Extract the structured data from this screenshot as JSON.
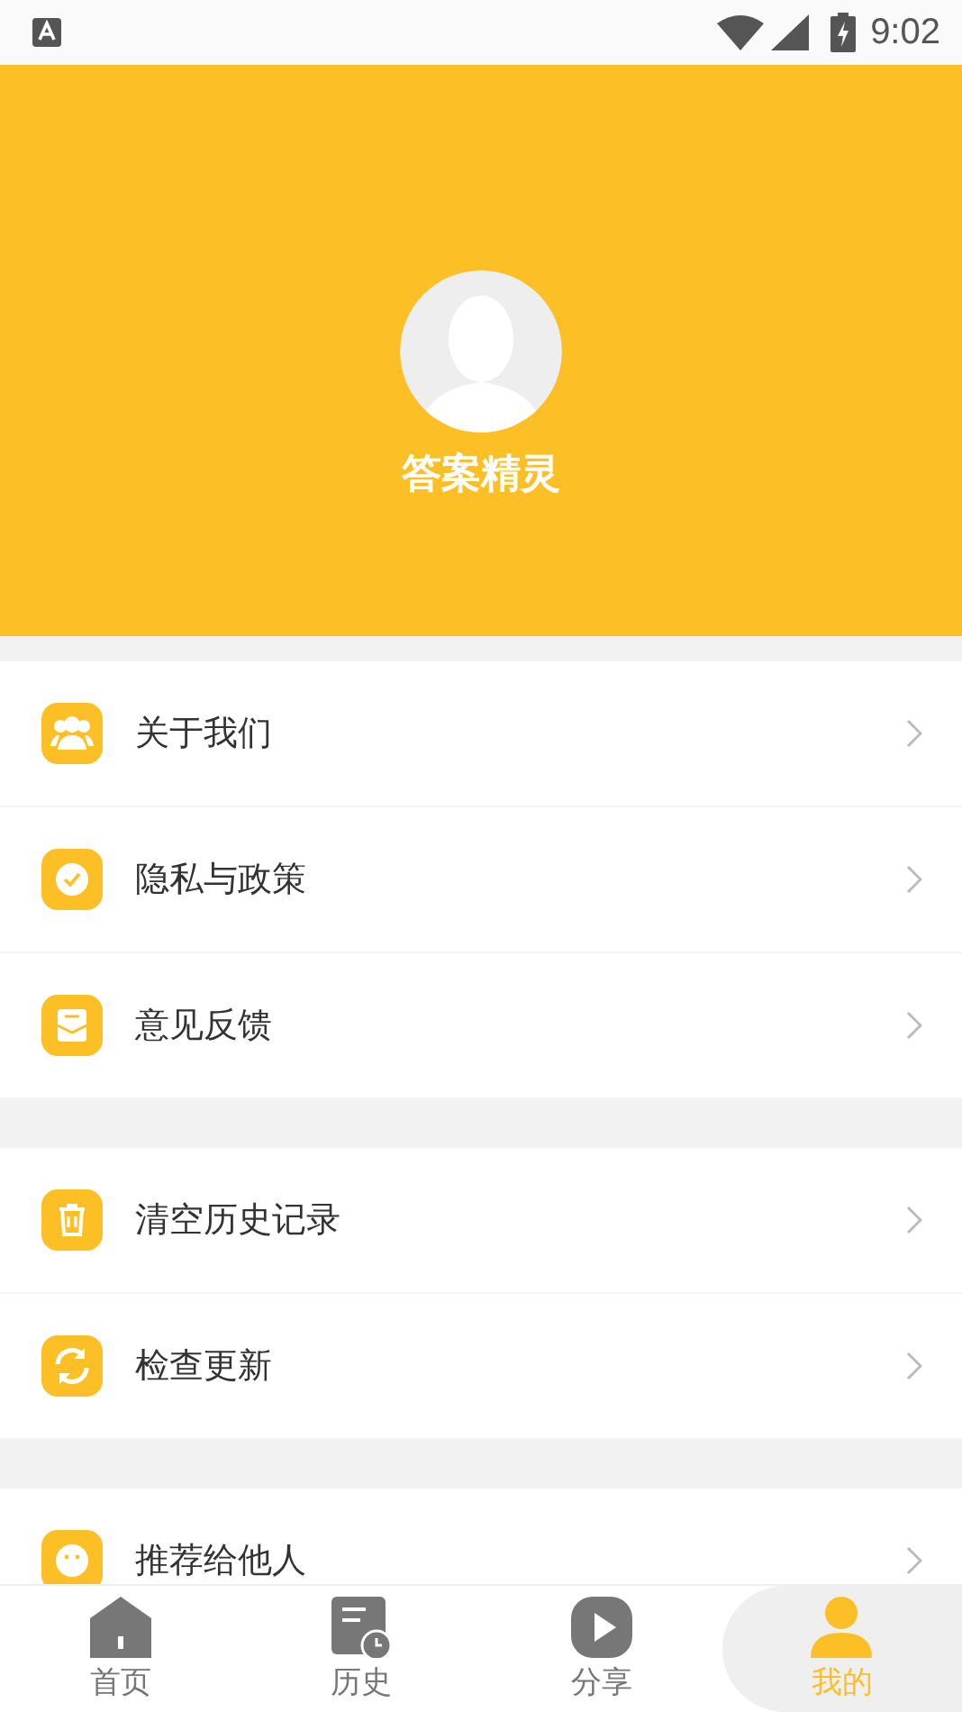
{
  "status_bar": {
    "time": "9:02"
  },
  "profile": {
    "name": "答案精灵"
  },
  "menu_groups": [
    {
      "items": [
        {
          "label": "关于我们"
        },
        {
          "label": "隐私与政策"
        },
        {
          "label": "意见反馈"
        }
      ]
    },
    {
      "items": [
        {
          "label": "清空历史记录"
        },
        {
          "label": "检查更新"
        }
      ]
    },
    {
      "items": [
        {
          "label": "推荐给他人"
        }
      ]
    }
  ],
  "bottom_nav": [
    {
      "label": "首页",
      "selected": false
    },
    {
      "label": "历史",
      "selected": false
    },
    {
      "label": "分享",
      "selected": false
    },
    {
      "label": "我的",
      "selected": true
    }
  ]
}
